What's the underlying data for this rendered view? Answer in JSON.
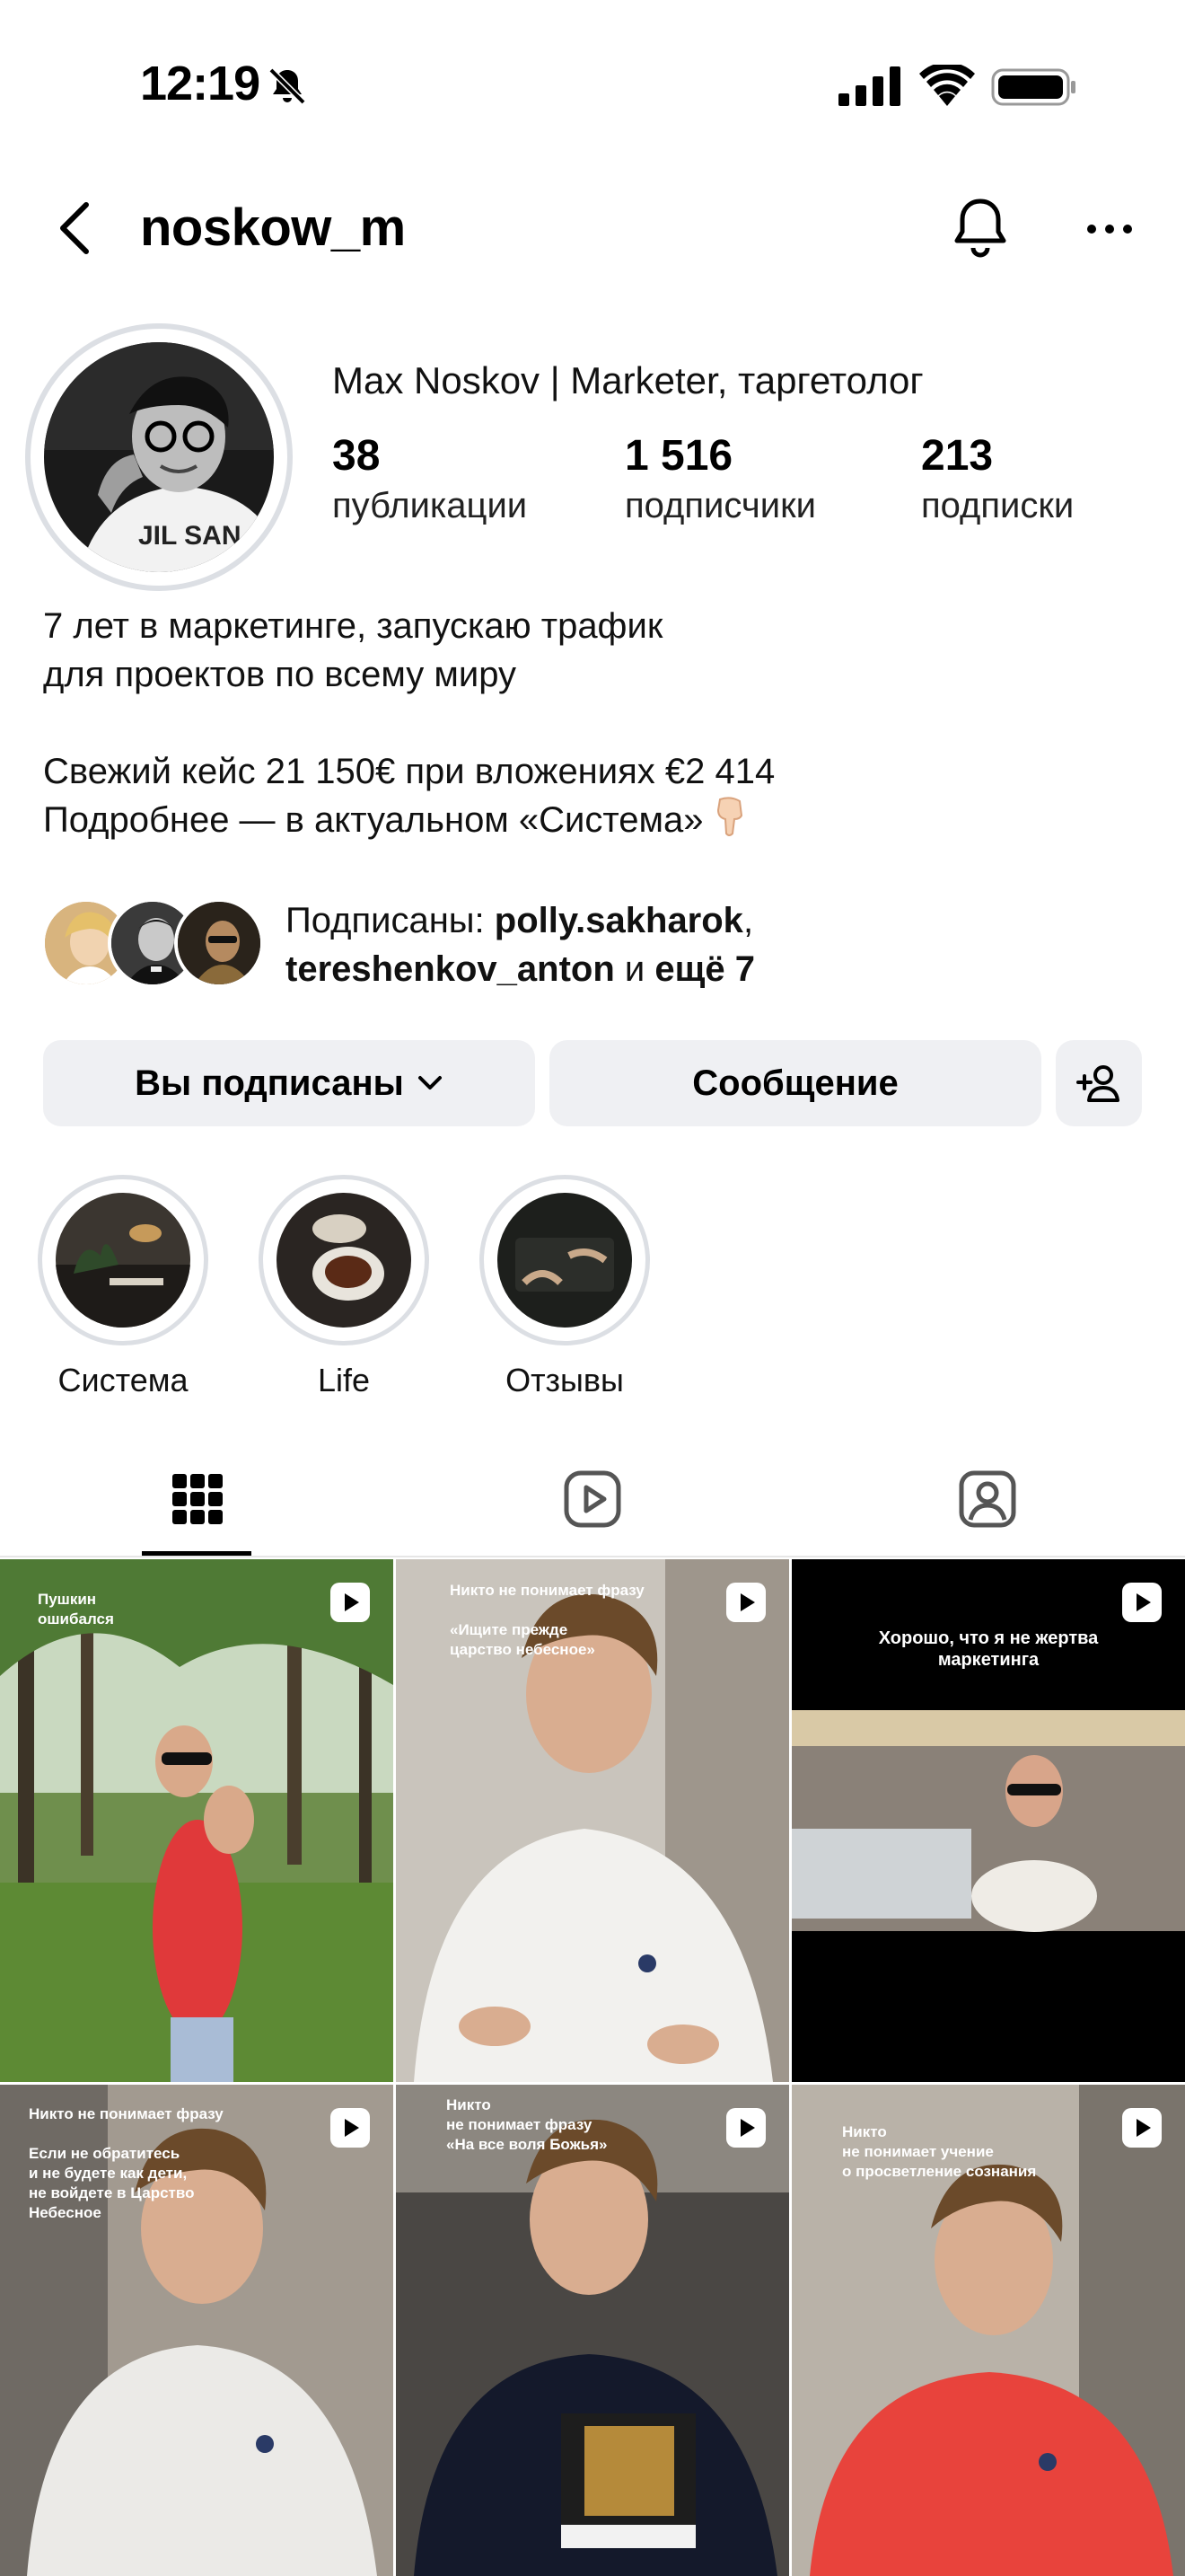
{
  "status_bar": {
    "time": "12:19"
  },
  "nav": {
    "username": "noskow_m"
  },
  "profile": {
    "name": "Max Noskov | Marketer, таргетолог",
    "stats": [
      {
        "value": "38",
        "label": "публикации"
      },
      {
        "value": "1 516",
        "label": "подписчики"
      },
      {
        "value": "213",
        "label": "подписки"
      }
    ],
    "bio": {
      "line1": "7 лет в маркетинге, запускаю трафик",
      "line2": "для проектов по всему миру",
      "line3": "Свежий кейс 21 150€ при вложениях €2 414",
      "line4": "Подробнее — в актуальном «Система»"
    },
    "mutual": {
      "prefix": "Подписаны: ",
      "user1": "polly.sakharok",
      "sep": ",",
      "user2": "tereshenkov_anton",
      "middle": " и ",
      "more": "ещё 7"
    }
  },
  "actions": {
    "following": "Вы подписаны",
    "message": "Сообщение"
  },
  "highlights": [
    {
      "label": "Система"
    },
    {
      "label": "Life"
    },
    {
      "label": "Отзывы"
    }
  ],
  "tabs": [
    "grid-icon",
    "reels-icon",
    "tagged-icon"
  ],
  "posts": [
    {
      "caption": "Пушкин\nошибался"
    },
    {
      "caption": "Никто не понимает фразу\n\n«Ищите прежде\nцарство небесное»"
    },
    {
      "caption": "Хорошо, что я не жертва\nмаркетинга"
    },
    {
      "caption": "Никто не понимает фразу\n\nЕсли не обратитесь\nи не будете как дети,\nне войдете в Царство\nНебесное"
    },
    {
      "caption": "Никто\nне понимает фразу\n«На все воля Божья»"
    },
    {
      "caption": "Никто\nне понимает учение\nо просветление сознания"
    }
  ]
}
